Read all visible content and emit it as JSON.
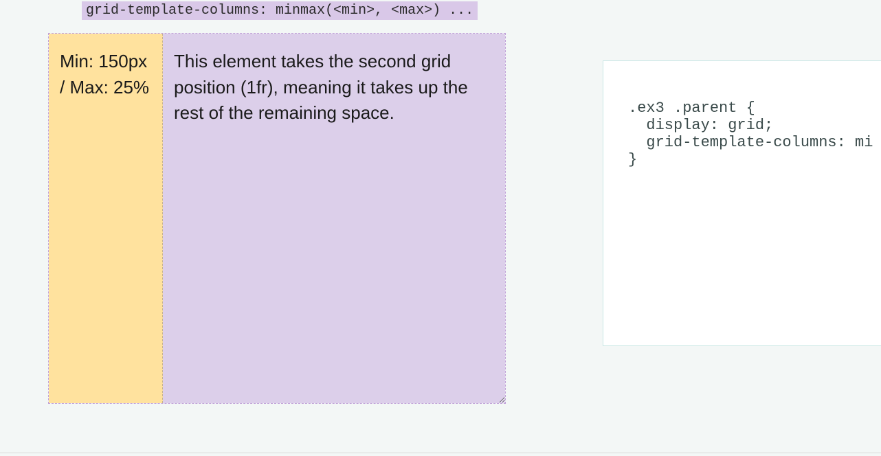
{
  "syntax": "grid-template-columns: minmax(<min>, <max>) ...",
  "demo": {
    "col1": "Min: 150px / Max: 25%",
    "col2": "This element takes the second grid position (1fr), meaning it takes up the rest of the remaining space."
  },
  "code": {
    "line1": ".ex3 .parent {",
    "line2": "display: grid;",
    "line3": "grid-template-columns: mi",
    "line4": "}"
  }
}
